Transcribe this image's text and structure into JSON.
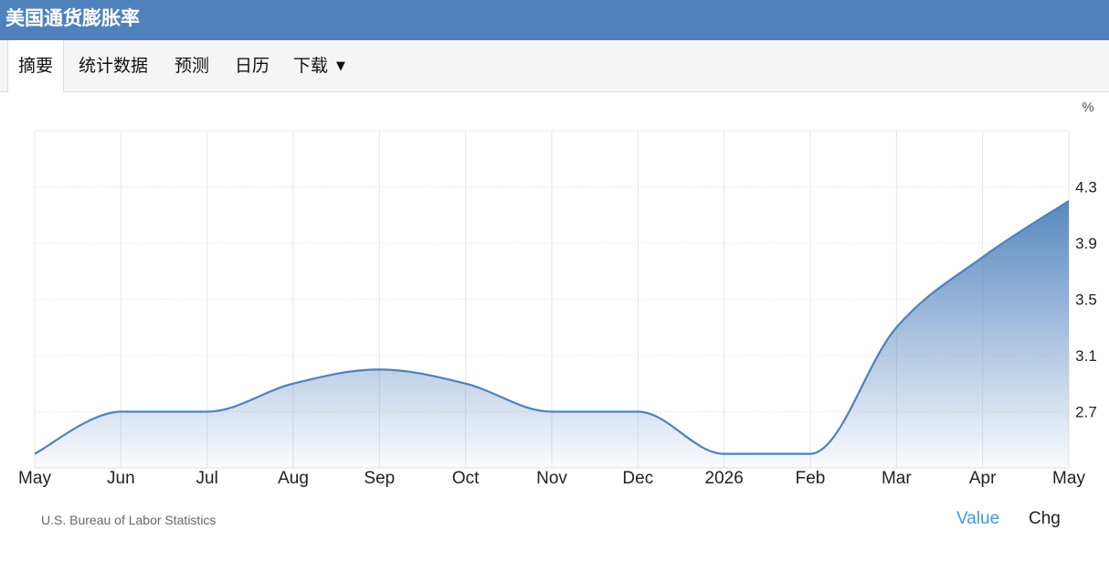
{
  "header": {
    "title": "美国通货膨胀率"
  },
  "tabs": [
    {
      "label": "摘要",
      "active": true
    },
    {
      "label": "统计数据",
      "active": false
    },
    {
      "label": "预测",
      "active": false
    },
    {
      "label": "日历",
      "active": false
    },
    {
      "label": "下载",
      "active": false,
      "has_dropdown": true
    }
  ],
  "footer": {
    "source": "U.S. Bureau of Labor Statistics",
    "value_link": "Value",
    "chg_link": "Chg"
  },
  "colors": {
    "header_bg": "#4f81bd",
    "line": "#4f81bd",
    "active_link": "#3d9be9"
  },
  "chart_data": {
    "type": "area",
    "unit_label": "%",
    "categories": [
      "May",
      "Jun",
      "Jul",
      "Aug",
      "Sep",
      "Oct",
      "Nov",
      "Dec",
      "2026",
      "Feb",
      "Mar",
      "Apr",
      "May"
    ],
    "values": [
      2.4,
      2.7,
      2.7,
      2.9,
      3.0,
      2.9,
      2.7,
      2.7,
      2.4,
      2.4,
      3.3,
      3.8,
      4.2
    ],
    "yticks": [
      2.7,
      3.1,
      3.5,
      3.9,
      4.3
    ],
    "ylim": [
      2.3,
      4.7
    ],
    "grid": true,
    "y_axis_position": "right"
  }
}
